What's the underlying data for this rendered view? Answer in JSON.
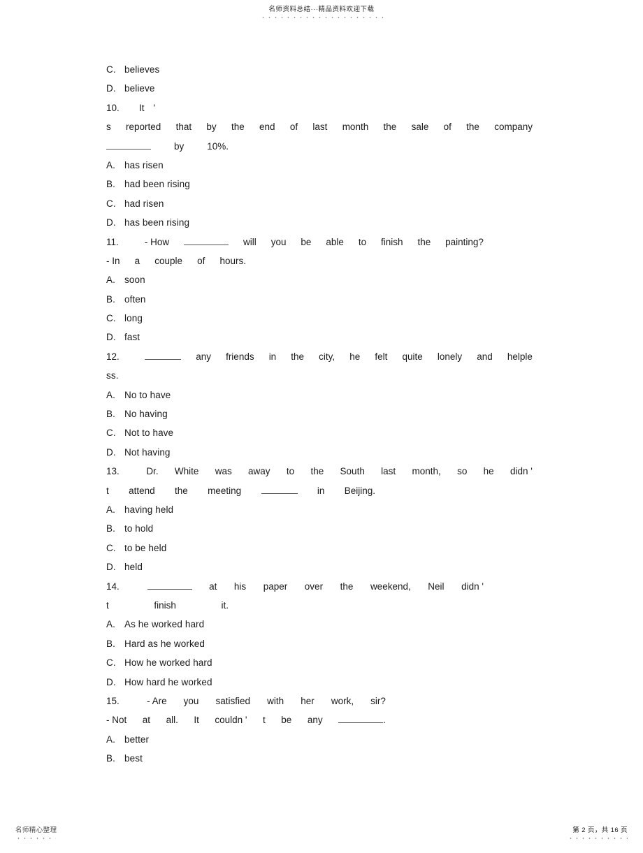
{
  "header": {
    "text": "名师资料总结···精品资料欢迎下载"
  },
  "footer": {
    "left_text": "名师精心整理",
    "page_text": "第 2 页，共 16 页"
  },
  "content": {
    "lines": [
      {
        "key": "C.",
        "value": "believes"
      },
      {
        "key": "D.",
        "value": "believe"
      },
      {
        "num": "10.",
        "words": [
          "It",
          "'"
        ]
      },
      {
        "words": [
          "s",
          "reported",
          "that",
          "by",
          "the",
          "end",
          "of",
          "last",
          "month",
          "the",
          "sale",
          "of",
          "the",
          "company"
        ]
      },
      {
        "words": [
          "by",
          "10%."
        ]
      },
      {
        "key": "A.",
        "value": "has   risen"
      },
      {
        "key": "B.",
        "value": "had   been   rising"
      },
      {
        "key": "C.",
        "value": "had   risen"
      },
      {
        "key": "D.",
        "value": "has   been   rising"
      },
      {
        "num": "11.",
        "words": [
          "- How",
          "will",
          "you",
          "be",
          "able",
          "to",
          "finish",
          "the",
          "painting?"
        ]
      },
      {
        "words": [
          "- In",
          "a",
          "couple",
          "of",
          "hours."
        ]
      },
      {
        "key": "A.",
        "value": "soon"
      },
      {
        "key": "B.",
        "value": "often"
      },
      {
        "key": "C.",
        "value": "long"
      },
      {
        "key": "D.",
        "value": "fast"
      },
      {
        "num": "12.",
        "words": [
          "any",
          "friends",
          "in",
          "the",
          "city,",
          "he",
          "felt",
          "quite",
          "lonely",
          "and",
          "helple"
        ]
      },
      {
        "words": [
          "ss."
        ]
      },
      {
        "key": "A.",
        "value": "No   to   have"
      },
      {
        "key": "B.",
        "value": "No   having"
      },
      {
        "key": "C.",
        "value": "Not   to   have"
      },
      {
        "key": "D.",
        "value": "Not   having"
      },
      {
        "num": "13.",
        "words": [
          "Dr.",
          "White",
          "was",
          "away",
          "to",
          "the",
          "South",
          "last",
          "month,",
          "so",
          "he",
          "didn'"
        ]
      },
      {
        "words": [
          "t",
          "attend",
          "the",
          "meeting",
          "in",
          "Beijing."
        ]
      },
      {
        "key": "A.",
        "value": "having   held"
      },
      {
        "key": "B.",
        "value": "to   hold"
      },
      {
        "key": "C.",
        "value": "to   be   held"
      },
      {
        "key": "D.",
        "value": "held"
      },
      {
        "num": "14.",
        "words": [
          "at",
          "his",
          "paper",
          "over",
          "the",
          "weekend,",
          "Neil",
          "didn'"
        ]
      },
      {
        "words": [
          "t",
          "finish",
          "it."
        ]
      },
      {
        "key": "A.",
        "value": "As   he   worked   hard"
      },
      {
        "key": "B.",
        "value": "Hard   as   he   worked"
      },
      {
        "key": "C.",
        "value": "How he   worked   hard"
      },
      {
        "key": "D.",
        "value": "How hard   he   worked"
      },
      {
        "num": "15.",
        "words": [
          "- Are",
          "you",
          "satisfied",
          "with",
          "her",
          "work,",
          "sir?"
        ]
      },
      {
        "words": [
          "- Not",
          "at",
          "all.",
          "It",
          "couldn'",
          "t",
          "be",
          "any",
          "."
        ]
      },
      {
        "key": "A.",
        "value": "better"
      },
      {
        "key": "B.",
        "value": "best"
      }
    ],
    "q10": {
      "num": "10.",
      "w1": "It",
      "w2": "'",
      "l2": [
        "s",
        "reported",
        "that",
        "by",
        "the",
        "end",
        "of",
        "last",
        "month",
        "the",
        "sale",
        "of",
        "the",
        "company"
      ],
      "l3": [
        "by",
        "10%."
      ],
      "options": [
        {
          "key": "A.",
          "value": "has   risen"
        },
        {
          "key": "B.",
          "value": "had   been   rising"
        },
        {
          "key": "C.",
          "value": "had   risen"
        },
        {
          "key": "D.",
          "value": "has   been   rising"
        }
      ]
    },
    "q09_tail": [
      {
        "key": "C.",
        "value": "believes"
      },
      {
        "key": "D.",
        "value": "believe"
      }
    ],
    "q11": {
      "num": "11.",
      "pre": "- How",
      "post": [
        "will",
        "you",
        "be",
        "able",
        "to",
        "finish",
        "the",
        "painting?"
      ],
      "l2": [
        "- In",
        "a",
        "couple",
        "of",
        "hours."
      ],
      "options": [
        {
          "key": "A.",
          "value": "soon"
        },
        {
          "key": "B.",
          "value": "often"
        },
        {
          "key": "C.",
          "value": "long"
        },
        {
          "key": "D.",
          "value": "fast"
        }
      ]
    },
    "q12": {
      "num": "12.",
      "post": [
        "any",
        "friends",
        "in",
        "the",
        "city,",
        "he",
        "felt",
        "quite",
        "lonely",
        "and",
        "helple"
      ],
      "l2": "ss.",
      "options": [
        {
          "key": "A.",
          "value": "No   to   have"
        },
        {
          "key": "B.",
          "value": "No   having"
        },
        {
          "key": "C.",
          "value": "Not   to   have"
        },
        {
          "key": "D.",
          "value": "Not   having"
        }
      ]
    },
    "q13": {
      "num": "13.",
      "l1": [
        "Dr.",
        "White",
        "was",
        "away",
        "to",
        "the",
        "South",
        "last",
        "month,",
        "so",
        "he",
        "didn '"
      ],
      "l2a": [
        "t",
        "attend",
        "the",
        "meeting"
      ],
      "l2b": [
        "in",
        "Beijing."
      ],
      "options": [
        {
          "key": "A.",
          "value": "having   held"
        },
        {
          "key": "B.",
          "value": "to   hold"
        },
        {
          "key": "C.",
          "value": "to   be   held"
        },
        {
          "key": "D.",
          "value": "held"
        }
      ]
    },
    "q14": {
      "num": "14.",
      "post": [
        "at",
        "his",
        "paper",
        "over",
        "the",
        "weekend,",
        "Neil",
        "didn '"
      ],
      "l2": [
        "t",
        "finish",
        "it."
      ],
      "options": [
        {
          "key": "A.",
          "value": "As   he   worked   hard"
        },
        {
          "key": "B.",
          "value": "Hard   as   he   worked"
        },
        {
          "key": "C.",
          "value": "How he   worked   hard"
        },
        {
          "key": "D.",
          "value": "How hard   he   worked"
        }
      ]
    },
    "q15": {
      "num": "15.",
      "l1": [
        "- Are",
        "you",
        "satisfied",
        "with",
        "her",
        "work,",
        "sir?"
      ],
      "l2a": [
        "- Not",
        "at",
        "all.",
        "It",
        "couldn '",
        "t",
        "be",
        "any"
      ],
      "l2b": ".",
      "options": [
        {
          "key": "A.",
          "value": "better"
        },
        {
          "key": "B.",
          "value": "best"
        }
      ]
    }
  }
}
